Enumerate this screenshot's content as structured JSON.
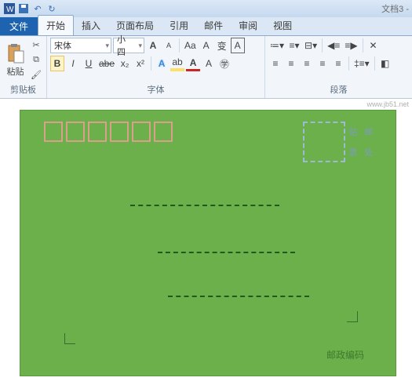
{
  "titlebar": {
    "doc_title": "文档3 -"
  },
  "watermark": "www.jb51.net",
  "tabs": {
    "file": "文件",
    "items": [
      "开始",
      "插入",
      "页面布局",
      "引用",
      "邮件",
      "审阅",
      "视图"
    ],
    "active_index": 0
  },
  "clipboard": {
    "paste": "粘贴",
    "label": "剪贴板"
  },
  "font": {
    "name": "宋体",
    "size": "小四",
    "label": "字体",
    "bold": "B",
    "italic": "I",
    "underline": "U",
    "strike": "abe",
    "sub": "x₂",
    "sup": "x²",
    "grow": "A",
    "shrink": "A",
    "case": "Aa",
    "clear": "A",
    "phonetic": "变",
    "border": "A",
    "effects": "A",
    "highlight": "ab",
    "color": "A"
  },
  "paragraph": {
    "label": "段落"
  },
  "envelope": {
    "stamp": {
      "c1": "贴",
      "c2": "邮",
      "c3": "票",
      "c4": "处"
    },
    "postcode_label": "邮政编码"
  }
}
